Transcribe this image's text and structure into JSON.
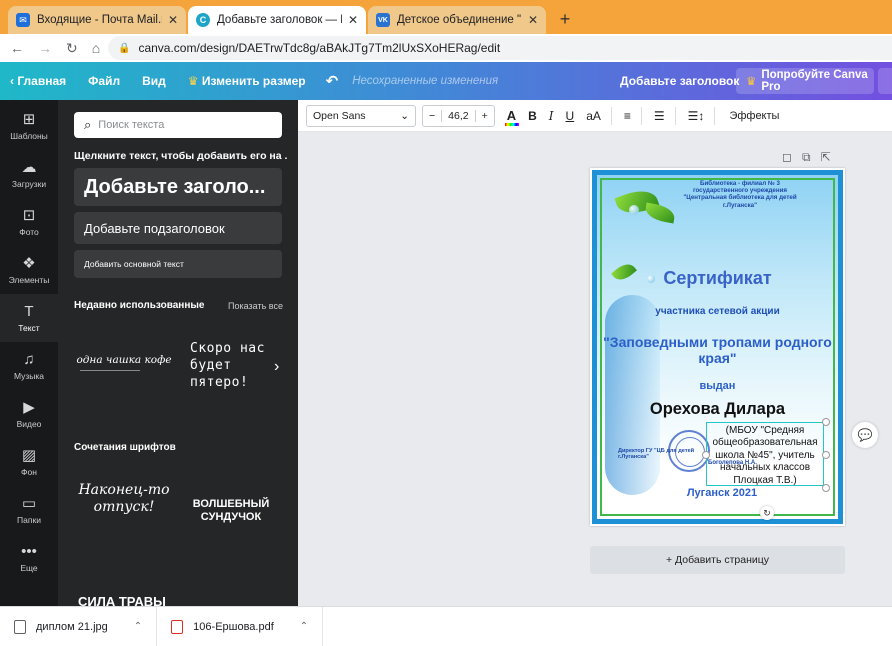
{
  "browser": {
    "tabs": [
      {
        "title": "Входящие - Почта Mail.ru",
        "color": "#1e6fd9",
        "glyph": "✉",
        "active": false
      },
      {
        "title": "Добавьте заголовок — Плакат",
        "color": "#1fa5c8",
        "glyph": "C",
        "active": true
      },
      {
        "title": "Детское объединение \"Береста",
        "color": "#2a73d0",
        "glyph": "VK",
        "active": false
      }
    ],
    "url": "canva.com/design/DAETrwTdc8g/aBAkJTg7Tm2lUxSXoHERag/edit"
  },
  "topbar": {
    "home": "Главная",
    "file": "Файл",
    "view": "Вид",
    "resize": "Изменить размер",
    "unsaved": "Несохраненные изменения",
    "doc_title": "Добавьте заголовок",
    "try_pro": "Попробуйте Canva Pro"
  },
  "rail": [
    {
      "label": "Шаблоны",
      "icon": "templates-icon",
      "glyph": "⊞"
    },
    {
      "label": "Загрузки",
      "icon": "upload-icon",
      "glyph": "☁"
    },
    {
      "label": "Фото",
      "icon": "photo-icon",
      "glyph": "⊡"
    },
    {
      "label": "Элементы",
      "icon": "elements-icon",
      "glyph": "❖"
    },
    {
      "label": "Текст",
      "icon": "text-icon",
      "glyph": "T"
    },
    {
      "label": "Музыка",
      "icon": "music-icon",
      "glyph": "♫"
    },
    {
      "label": "Видео",
      "icon": "video-icon",
      "glyph": "▶"
    },
    {
      "label": "Фон",
      "icon": "background-icon",
      "glyph": "▨"
    },
    {
      "label": "Папки",
      "icon": "folder-icon",
      "glyph": "▭"
    },
    {
      "label": "Еще",
      "icon": "more-icon",
      "glyph": "•••"
    }
  ],
  "panel": {
    "search_placeholder": "Поиск текста",
    "hint": "Щелкните текст, чтобы добавить его на ...",
    "heading": "Добавьте заголо...",
    "subheading": "Добавьте подзаголовок",
    "body": "Добавить основной текст",
    "recent_title": "Недавно использованные",
    "see_all": "Показать все",
    "recent1": "одна чашка кофе",
    "recent2": "Скоро нас будет пятеро!",
    "combos_title": "Сочетания шрифтов",
    "combo1": "Наконец-то отпуск!",
    "combo2": "ВОЛШЕБНЫЙ СУНДУЧОК",
    "combo3": "СИЛА ТРАВЫ"
  },
  "toolbar": {
    "font": "Open Sans",
    "minus": "−",
    "size": "46,2",
    "plus": "+",
    "effects": "Эффекты"
  },
  "certificate": {
    "library": "Библиотека - филиал № 3 государственного учреждения \"Центральная библиотека для детей г.Луганска\"",
    "title": "Сертификат",
    "participant": "участника сетевой акции",
    "action": "\"Заповедными тропами родного края\"",
    "issued": "выдан",
    "name": "Орехова Дилара",
    "school": "(МБОУ \"Средняя общеобразовательная школа №45\", учитель начальных классов Плоцкая Т.В.)",
    "director": "Директор ГУ \"ЦБ для детей г.Луганска\"",
    "signature": "Боголепова Н.А.",
    "city_year": "Луганск 2021"
  },
  "add_page": "+ Добавить страницу",
  "downloads": [
    {
      "name": "диплом 21.jpg",
      "type": "image"
    },
    {
      "name": "106-Ершова.pdf",
      "type": "pdf"
    }
  ]
}
